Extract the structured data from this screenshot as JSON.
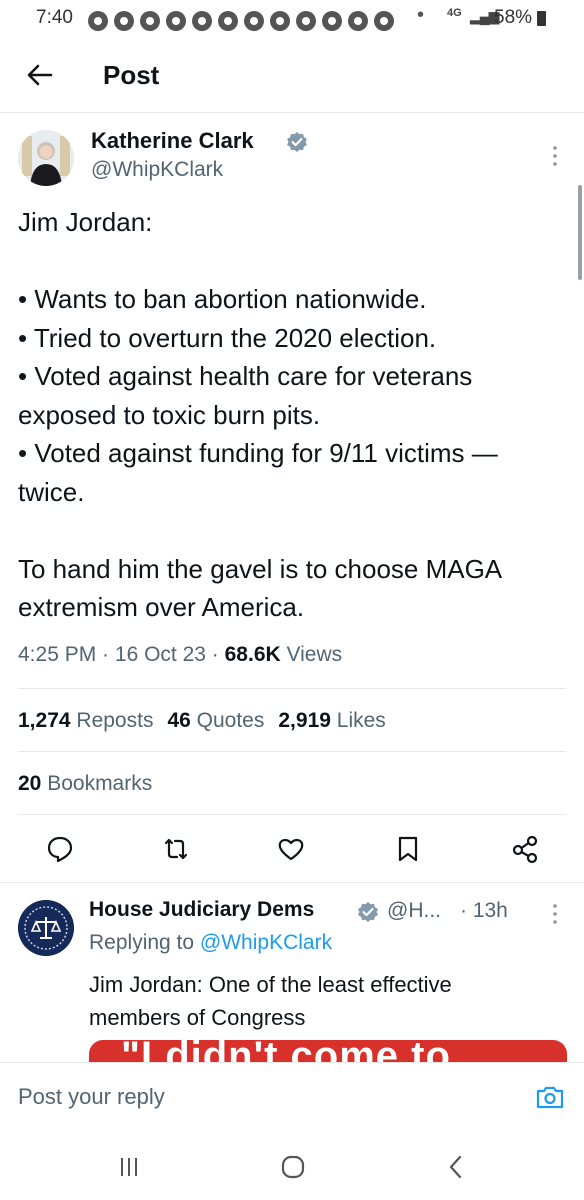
{
  "status_bar": {
    "time": "7:40",
    "network": "4G",
    "battery": "58%",
    "notification_icons": [
      "chrome-icon",
      "chrome-icon",
      "chrome-icon",
      "chrome-icon",
      "chrome-icon",
      "chrome-icon",
      "chrome-icon",
      "chrome-icon",
      "chrome-icon",
      "chrome-icon",
      "chrome-icon",
      "chrome-icon"
    ]
  },
  "header": {
    "title": "Post"
  },
  "tweet": {
    "author_name": "Katherine Clark",
    "handle": "@WhipKClark",
    "text": "Jim Jordan:\n\n• Wants to ban abortion nationwide.\n• Tried to overturn the 2020 election.\n• Voted against health care for veterans exposed to toxic burn pits.\n• Voted against funding for 9/11 victims — twice.\n\nTo hand him the gavel is to choose MAGA extremism over America.",
    "time": "4:25 PM",
    "date": "16 Oct 23",
    "views_count": "68.6K",
    "views_label": "Views",
    "reposts_count": "1,274",
    "reposts_label": "Reposts",
    "quotes_count": "46",
    "quotes_label": "Quotes",
    "likes_count": "2,919",
    "likes_label": "Likes",
    "bookmarks_count": "20",
    "bookmarks_label": "Bookmarks"
  },
  "reply": {
    "author_name": "House Judiciary Dems",
    "handle": "@H...",
    "time": "· 13h",
    "replying_prefix": "Replying to",
    "replying_to": "@WhipKClark",
    "text": "Jim Jordan: One of the least effective members of Congress",
    "media_text": "\"I didn't come to"
  },
  "composer": {
    "placeholder": "Post your reply"
  },
  "colors": {
    "accent": "#1d9bf0",
    "verified": "#829aab",
    "muted": "#536471",
    "media_red": "#d8302a"
  }
}
